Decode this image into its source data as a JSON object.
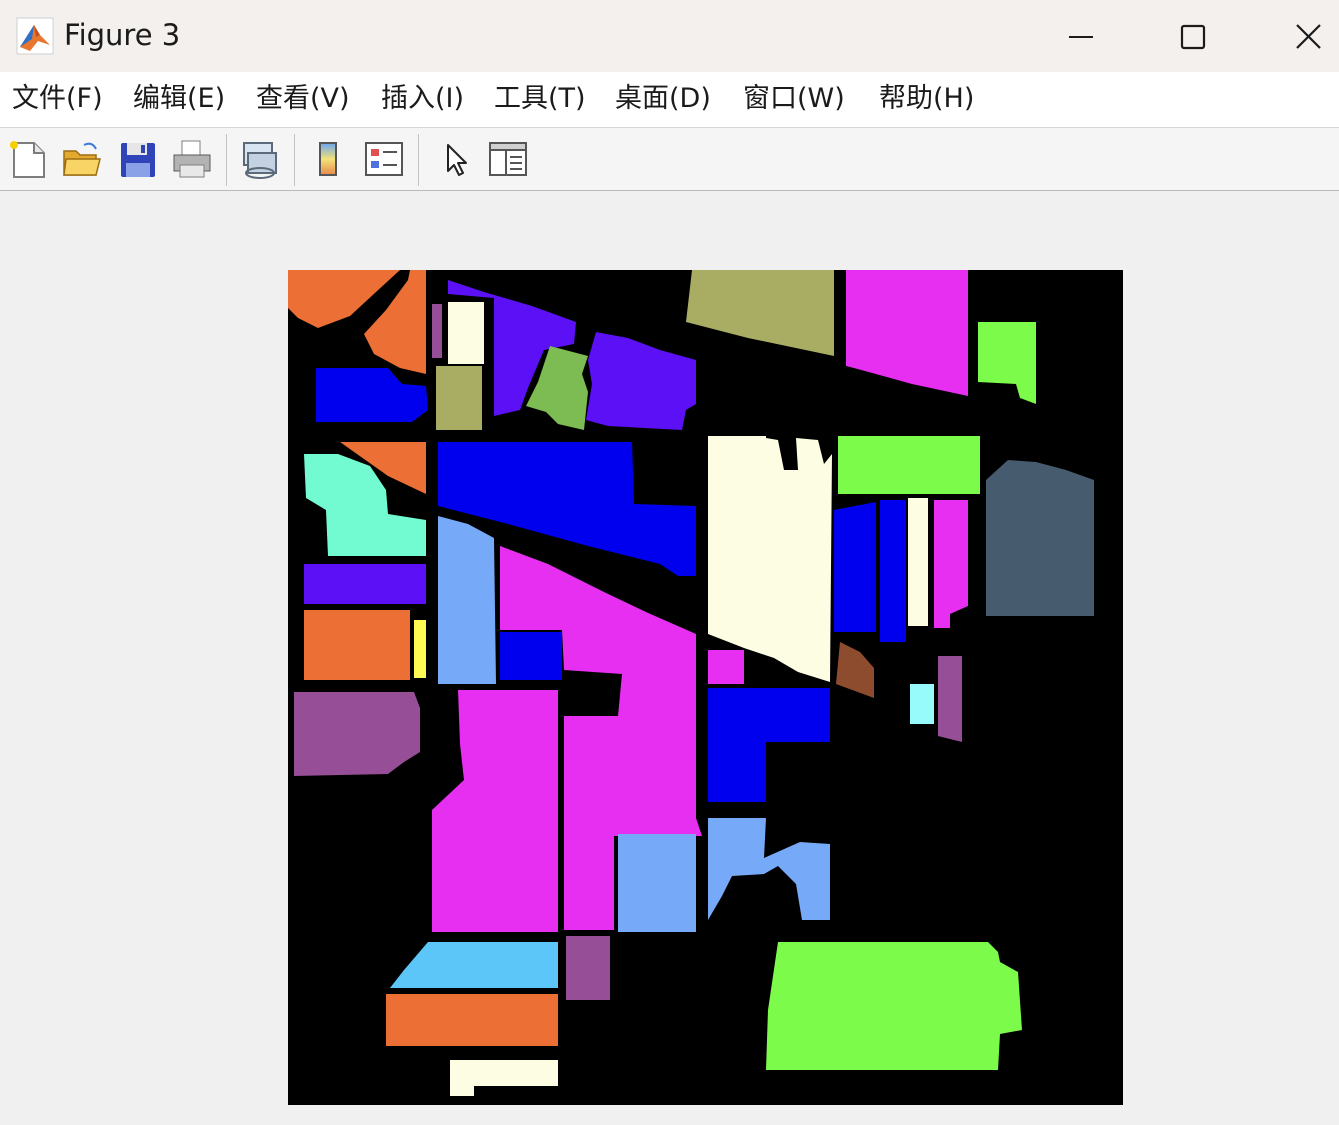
{
  "window": {
    "title": "Figure 3",
    "controls": {
      "minimize": "minimize-icon",
      "maximize": "maximize-icon",
      "close": "close-icon"
    }
  },
  "menubar": {
    "items": [
      {
        "label": "文件(F)"
      },
      {
        "label": "编辑(E)"
      },
      {
        "label": "查看(V)"
      },
      {
        "label": "插入(I)"
      },
      {
        "label": "工具(T)"
      },
      {
        "label": "桌面(D)"
      },
      {
        "label": "窗口(W)"
      },
      {
        "label": "帮助(H)"
      }
    ]
  },
  "toolbar": {
    "tools": [
      "new-figure-icon",
      "open-file-icon",
      "save-icon",
      "print-icon",
      "link-plot-icon",
      "colorbar-icon",
      "legend-icon",
      "pointer-icon",
      "property-editor-icon"
    ]
  },
  "image": {
    "description_colors": {
      "background": "#000000",
      "orange": "#ec6f35",
      "blue": "#0000ee",
      "violet": "#5b10f5",
      "magenta": "#e62ff0",
      "light_blue": "#76aaf8",
      "green": "#7dfb4b",
      "cream": "#fcfde3",
      "olive": "#a9ad63",
      "purple": "#964f96",
      "aquamarine": "#72fbd0",
      "slate": "#465b6d",
      "sky": "#5bc6f7",
      "cyan": "#97fbfb",
      "brown": "#8e4c2e",
      "yellow": "#fdfb53"
    }
  }
}
